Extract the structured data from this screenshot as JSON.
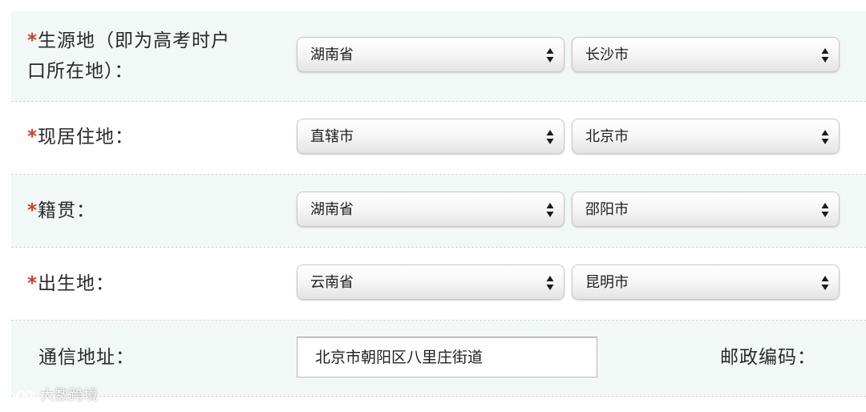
{
  "required_mark": "*",
  "colors": {
    "required": "#cc3b2c",
    "shaded_row": "#f1f8f5"
  },
  "fields": {
    "origin": {
      "label": "生源地（即为高考时户口所在地）：",
      "label_line1": "生源地（即为高考时户",
      "label_line2": "口所在地）：",
      "province": "湖南省",
      "city": "长沙市"
    },
    "residence": {
      "label": "现居住地：",
      "province": "直辖市",
      "city": "北京市"
    },
    "native_place": {
      "label": "籍贯：",
      "province": "湖南省",
      "city": "邵阳市"
    },
    "birthplace": {
      "label": "出生地：",
      "province": "云南省",
      "city": "昆明市"
    },
    "mailing_address": {
      "label": "通信地址：",
      "value": "北京市朝阳区八里庄街道"
    },
    "postal_code": {
      "label": "邮政编码："
    }
  },
  "watermark": {
    "text": "大数跨境",
    "icon": "watermark-logo-icon"
  }
}
